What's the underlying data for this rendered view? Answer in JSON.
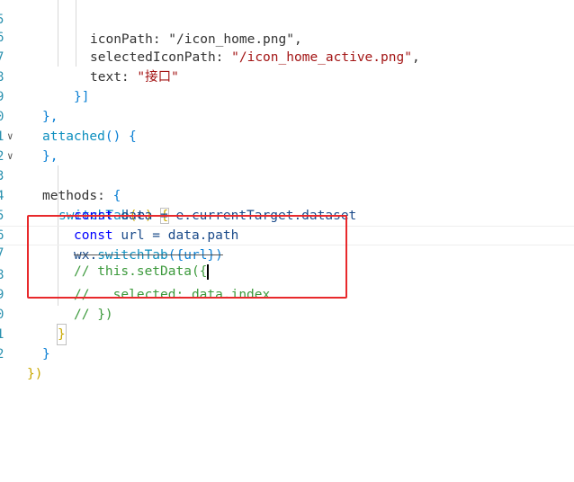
{
  "gutter": {
    "numbers": [
      "5",
      "6",
      "7",
      "8",
      "9",
      "0",
      "1",
      "2",
      "3",
      "4",
      "5",
      "6",
      "7",
      "8",
      "9",
      "0",
      "1",
      "2"
    ],
    "fold_markers": [
      "",
      "",
      "",
      "",
      "",
      "",
      "",
      "chevron-down-icon",
      "chevron-down-icon",
      "",
      "",
      "",
      "",
      "",
      "",
      "",
      "",
      ""
    ]
  },
  "code": {
    "l1_key": "iconPath: \"/icon_home.png\",",
    "l2_key": "selectedIconPath: ",
    "l2_val": "\"/icon_home_active.png\"",
    "l2_end": ",",
    "l3_key": "text: ",
    "l3_val": "\"接口\"",
    "l4": "}]",
    "l5": "},",
    "l6_fn": "attached",
    "l6_rest": "() {",
    "l7": "},",
    "l8_key": "methods: ",
    "l8_brace": "{",
    "l9_fn": "switchTab",
    "l9_paren_open": "(",
    "l9_arg": "e",
    "l9_paren_close": ")",
    "l9_brace": "{",
    "l10_kw": "const",
    "l10_rest": " data = e.currentTarget.dataset",
    "l11_kw": "const",
    "l11_rest": " url = data.path",
    "l12_obj": "wx.",
    "l12_fn": "switchTab",
    "l12_rest": "({url})",
    "l13": "// this.setData({",
    "l14": "//   selected: data.index",
    "l15": "// })",
    "l16": "}",
    "l17": "}",
    "l18": "})"
  }
}
